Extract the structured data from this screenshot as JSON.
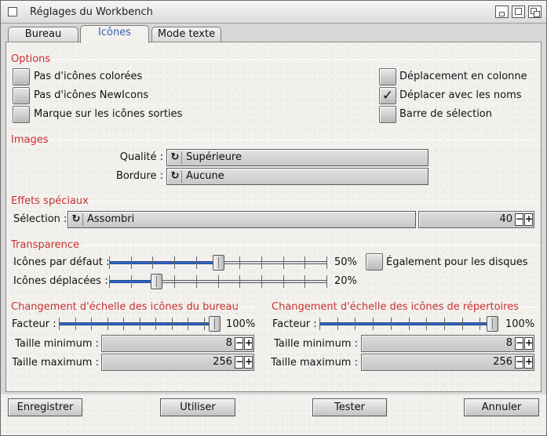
{
  "window": {
    "title": "Réglages du Workbench"
  },
  "tabs": [
    {
      "label": "Bureau",
      "active": false
    },
    {
      "label": "Icônes",
      "active": true
    },
    {
      "label": "Mode texte",
      "active": false
    }
  ],
  "options": {
    "header": "Options",
    "checkboxes": [
      {
        "label": "Pas d'icônes colorées",
        "checked": false
      },
      {
        "label": "Pas d'icônes NewIcons",
        "checked": false
      },
      {
        "label": "Marque sur les icônes sorties",
        "checked": false
      },
      {
        "label": "Déplacement en colonne",
        "checked": false
      },
      {
        "label": "Déplacer avec les noms",
        "checked": true
      },
      {
        "label": "Barre de sélection",
        "checked": false
      }
    ],
    "check_glyph": "✓"
  },
  "images": {
    "header": "Images",
    "quality_label": "Qualité :",
    "quality_value": "Supérieure",
    "border_label": "Bordure :",
    "border_value": "Aucune"
  },
  "effects": {
    "header": "Effets spéciaux",
    "selection_label": "Sélection :",
    "selection_value": "Assombri",
    "selection_amount": "40"
  },
  "transparency": {
    "header": "Transparence",
    "default_label": "Icônes par défaut :",
    "default_value": 50,
    "default_text": "50%",
    "moved_label": "Icônes déplacées :",
    "moved_value": 20,
    "moved_text": "20%",
    "disks_label": "Également pour les disques",
    "disks_checked": false
  },
  "desktop_scaling": {
    "header": "Changement d'échelle des icônes du bureau",
    "factor_label": "Facteur :",
    "factor_value": 100,
    "factor_text": "100%",
    "min_label": "Taille minimum :",
    "min_value": "8",
    "max_label": "Taille maximum :",
    "max_value": "256"
  },
  "dir_scaling": {
    "header": "Changement d'échelle des icônes de répertoires",
    "factor_label": "Facteur :",
    "factor_value": 100,
    "factor_text": "100%",
    "min_label": "Taille minimum :",
    "min_value": "8",
    "max_label": "Taille maximum :",
    "max_value": "256"
  },
  "stepper": {
    "minus": "−",
    "plus": "+"
  },
  "cycle_glyph": "↻",
  "buttons": {
    "save": "Enregistrer",
    "use": "Utiliser",
    "test": "Tester",
    "cancel": "Annuler"
  }
}
